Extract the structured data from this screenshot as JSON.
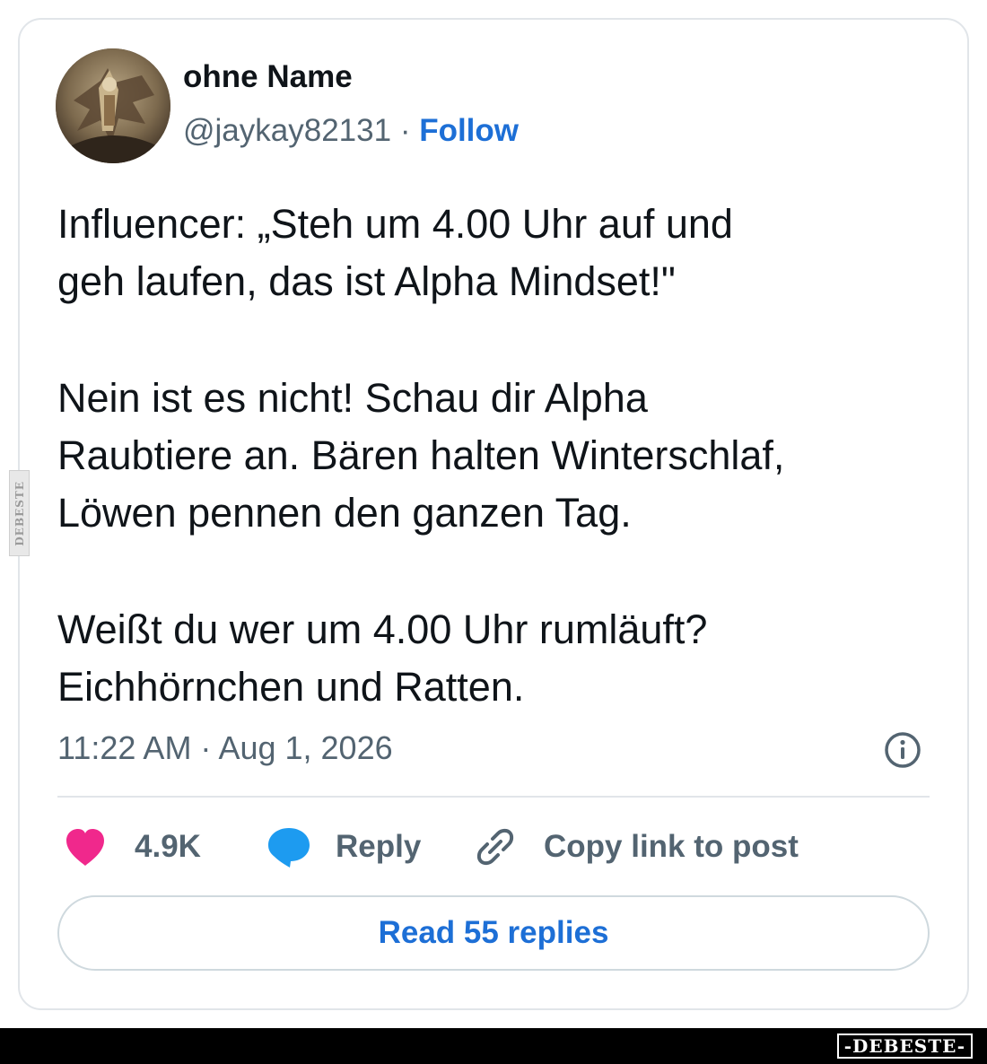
{
  "author": {
    "display_name": "ohne Name",
    "handle": "@jaykay82131",
    "separator": "·",
    "follow_label": "Follow"
  },
  "tweet": {
    "paragraphs": [
      [
        "Influencer: „Steh um 4.00 Uhr auf und",
        "geh laufen, das ist Alpha Mindset!\""
      ],
      [
        "Nein ist es nicht! Schau dir Alpha",
        "Raubtiere an. Bären halten Winterschlaf,",
        "Löwen pennen den ganzen Tag."
      ],
      [
        "Weißt du wer um 4.00 Uhr rumläuft?",
        "Eichhörnchen und Ratten."
      ]
    ],
    "timestamp": "11:22 AM · Aug 1, 2026"
  },
  "actions": {
    "like_count": "4.9K",
    "reply_label": "Reply",
    "copy_link_label": "Copy link to post"
  },
  "read_replies_label": "Read 55 replies",
  "watermarks": {
    "side": "DEBESTE",
    "footer": "-DEBESTE-"
  },
  "colors": {
    "like": "#f0288c",
    "reply": "#1d9bf0",
    "link": "#1d6fd6",
    "secondary_text": "#536471"
  },
  "icons": {
    "info": "info-icon",
    "like": "heart-icon",
    "reply": "speech-bubble-icon",
    "copy_link": "link-icon"
  }
}
